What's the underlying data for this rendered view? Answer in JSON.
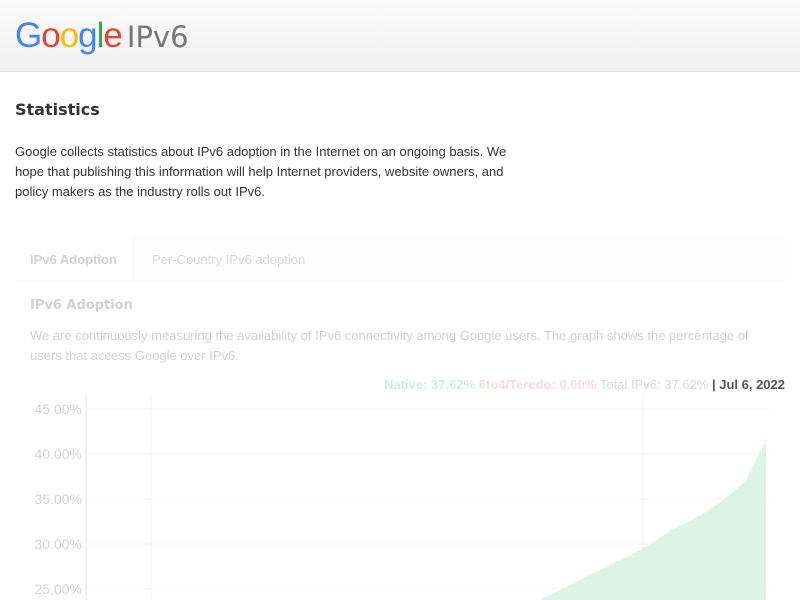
{
  "header": {
    "logo_letters": [
      {
        "char": "G",
        "color": "#4285f4"
      },
      {
        "char": "o",
        "color": "#ea4335"
      },
      {
        "char": "o",
        "color": "#fbbc05"
      },
      {
        "char": "g",
        "color": "#4285f4"
      },
      {
        "char": "l",
        "color": "#34a853"
      },
      {
        "char": "e",
        "color": "#ea4335"
      }
    ],
    "product": "IPv6"
  },
  "main": {
    "title": "Statistics",
    "intro": "Google collects statistics about IPv6 adoption in the Internet on an ongoing basis. We hope that publishing this information will help Internet providers, website owners, and policy makers as the industry rolls out IPv6."
  },
  "tabs": [
    {
      "label": "IPv6 Adoption",
      "active": true
    },
    {
      "label": "Per-Country IPv6 adoption",
      "active": false
    }
  ],
  "panel": {
    "heading": "IPv6 Adoption",
    "description": "We are continuously measuring the availability of IPv6 connectivity among Google users. The graph shows the percentage of users that access Google over IPv6."
  },
  "legend": {
    "native": "Native: 37.62%",
    "sixto4": "6to4/Teredo: 0.00%",
    "total": "Total IPv6: 37.62%",
    "separator": "|",
    "date": "Jul 6, 2022"
  },
  "chart_data": {
    "type": "area",
    "y_tick_labels": [
      "45.00%",
      "40.00%",
      "35.00%",
      "30.00%",
      "25.00%"
    ],
    "y_ticks": [
      45,
      40,
      35,
      30,
      25
    ],
    "ylim_visible": [
      22.5,
      46.5
    ],
    "x": [
      0.625,
      0.66,
      0.7,
      0.74,
      0.78,
      0.82,
      0.86,
      0.9,
      0.94,
      0.97,
      1.0
    ],
    "values": [
      22.4,
      23.5,
      25.0,
      26.5,
      28.0,
      29.5,
      31.5,
      33.0,
      35.0,
      37.0,
      41.5
    ],
    "series": [
      {
        "values": [
          22.4,
          23.5,
          25.0,
          26.5,
          28.0,
          29.5,
          31.5,
          33.0,
          35.0,
          37.0,
          41.5
        ]
      }
    ],
    "colors": {
      "area": "#7fcf9e",
      "grid": "#dddddd"
    }
  }
}
